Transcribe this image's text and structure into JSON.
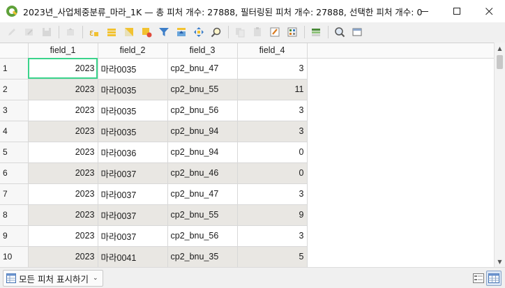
{
  "window": {
    "title": "2023년_사업체중분류_마라_1K — 총 피처 개수: 27888, 필터링된 피처 개수: 27888, 선택한 피처 개수: 0"
  },
  "toolbar": {
    "icons": [
      "pencil-icon",
      "multi-edit-icon",
      "save-icon",
      "reload-icon",
      "new-field-calc-icon",
      "select-all-icon",
      "invert-selection-icon",
      "deselect-icon",
      "filter-select-icon",
      "move-selection-top-icon",
      "pan-to-selection-icon",
      "zoom-to-selection-icon",
      "copy-rows-icon",
      "paste-rows-icon",
      "field-calculator-icon",
      "conditional-format-icon",
      "organize-columns-icon",
      "dock-icon",
      "actions-icon"
    ]
  },
  "table": {
    "headers": [
      "field_1",
      "field_2",
      "field_3",
      "field_4"
    ],
    "rows": [
      {
        "num": "1",
        "f1": "2023",
        "f2": "마라0035",
        "f3": "cp2_bnu_47",
        "f4": "3"
      },
      {
        "num": "2",
        "f1": "2023",
        "f2": "마라0035",
        "f3": "cp2_bnu_55",
        "f4": "11"
      },
      {
        "num": "3",
        "f1": "2023",
        "f2": "마라0035",
        "f3": "cp2_bnu_56",
        "f4": "3"
      },
      {
        "num": "4",
        "f1": "2023",
        "f2": "마라0035",
        "f3": "cp2_bnu_94",
        "f4": "3"
      },
      {
        "num": "5",
        "f1": "2023",
        "f2": "마라0036",
        "f3": "cp2_bnu_94",
        "f4": "0"
      },
      {
        "num": "6",
        "f1": "2023",
        "f2": "마라0037",
        "f3": "cp2_bnu_46",
        "f4": "0"
      },
      {
        "num": "7",
        "f1": "2023",
        "f2": "마라0037",
        "f3": "cp2_bnu_47",
        "f4": "3"
      },
      {
        "num": "8",
        "f1": "2023",
        "f2": "마라0037",
        "f3": "cp2_bnu_55",
        "f4": "9"
      },
      {
        "num": "9",
        "f1": "2023",
        "f2": "마라0037",
        "f3": "cp2_bnu_56",
        "f4": "3"
      },
      {
        "num": "10",
        "f1": "2023",
        "f2": "마라0041",
        "f3": "cp2_bnu_35",
        "f4": "5"
      }
    ]
  },
  "bottom": {
    "filter_label": "모든 피처 표시하기"
  },
  "colors": {
    "active_cell_border": "#3bd38b",
    "alt_row": "#e9e7e3"
  }
}
